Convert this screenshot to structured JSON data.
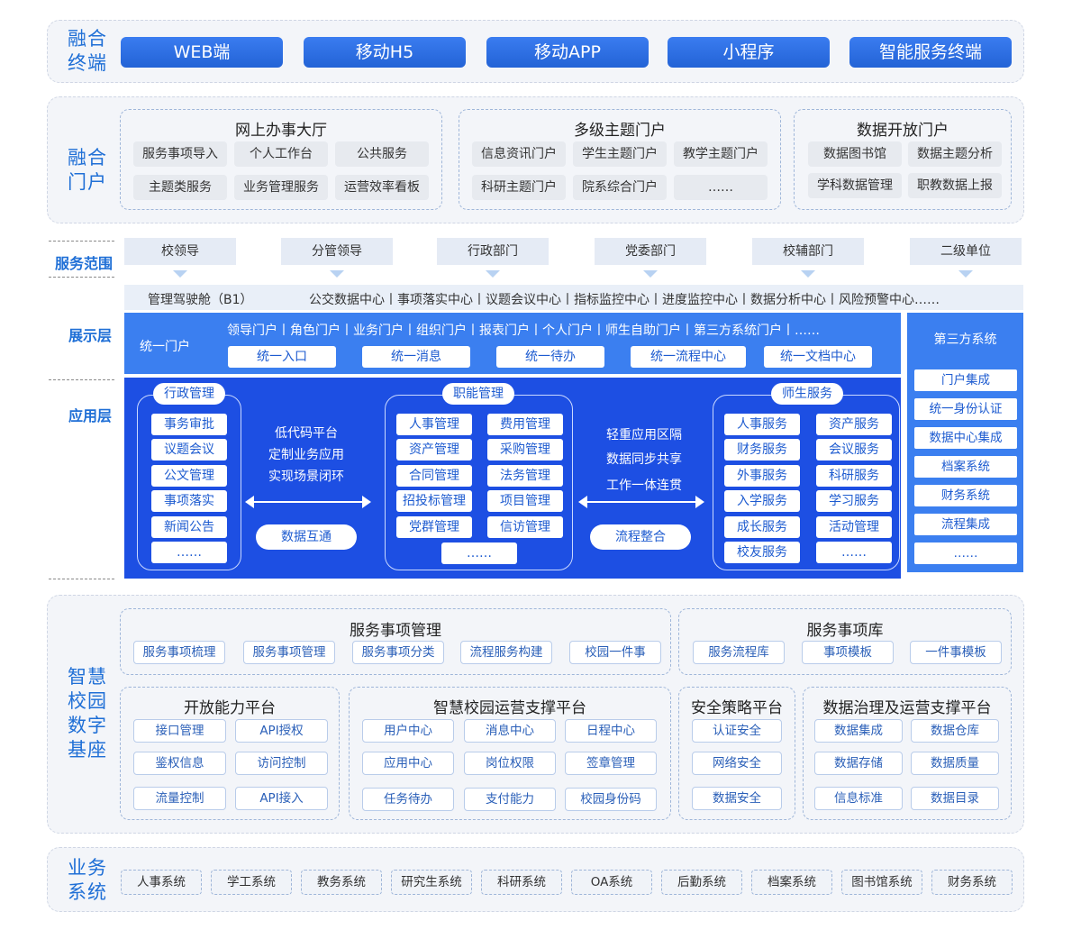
{
  "terminal": {
    "label": [
      "融合",
      "终端"
    ],
    "buttons": [
      "WEB端",
      "移动H5",
      "移动APP",
      "小程序",
      "智能服务终端"
    ]
  },
  "portal": {
    "label": [
      "融合",
      "门户"
    ],
    "groups": [
      {
        "title": "网上办事大厅",
        "items": [
          "服务事项导入",
          "个人工作台",
          "公共服务",
          "主题类服务",
          "业务管理服务",
          "运营效率看板"
        ]
      },
      {
        "title": "多级主题门户",
        "items": [
          "信息资讯门户",
          "学生主题门户",
          "教学主题门户",
          "科研主题门户",
          "院系综合门户",
          "……"
        ]
      },
      {
        "title": "数据开放门户",
        "items": [
          "数据图书馆",
          "数据主题分析",
          "学科数据管理",
          "职教数据上报"
        ]
      }
    ]
  },
  "scope": {
    "label": "服务范围",
    "items": [
      "校领导",
      "分管领导",
      "行政部门",
      "党委部门",
      "校辅部门",
      "二级单位"
    ]
  },
  "cockpit": {
    "title": "管理驾驶舱（B1）",
    "items": "公交数据中心丨事项落实中心丨议题会议中心丨指标监控中心丨进度监控中心丨数据分析中心丨风险预警中心……"
  },
  "display": {
    "label": "展示层",
    "portal_name": "统一门户",
    "portal_list": "领导门户丨角色门户丨业务门户丨组织门户丨报表门户丨个人门户丨师生自助门户丨第三方系统门户丨……",
    "buttons": [
      "统一入口",
      "统一消息",
      "统一待办",
      "统一流程中心",
      "统一文档中心"
    ]
  },
  "app": {
    "label": "应用层",
    "admin": {
      "title": "行政管理",
      "items": [
        "事务审批",
        "议题会议",
        "公文管理",
        "事项落实",
        "新闻公告",
        "……"
      ]
    },
    "mid_text": [
      "低代码平台",
      "定制业务应用",
      "实现场景闭环"
    ],
    "mid_pill": "数据互通",
    "func": {
      "title": "职能管理",
      "left": [
        "人事管理",
        "资产管理",
        "合同管理",
        "招投标管理",
        "党群管理"
      ],
      "right": [
        "费用管理",
        "采购管理",
        "法务管理",
        "项目管理",
        "信访管理"
      ],
      "more": "……"
    },
    "mid2_text": [
      "轻重应用区隔",
      "数据同步共享",
      "工作一体连贯"
    ],
    "mid2_pill": "流程整合",
    "service": {
      "title": "师生服务",
      "left": [
        "人事服务",
        "财务服务",
        "外事服务",
        "入学服务",
        "成长服务",
        "校友服务"
      ],
      "right": [
        "资产服务",
        "会议服务",
        "科研服务",
        "学习服务",
        "活动管理",
        "……"
      ]
    }
  },
  "third": {
    "title": "第三方系统",
    "items": [
      "门户集成",
      "统一身份认证",
      "数据中心集成",
      "档案系统",
      "财务系统",
      "流程集成",
      "……"
    ]
  },
  "base": {
    "label": [
      "智慧",
      "校园",
      "数字",
      "基座"
    ],
    "svc_mgmt": {
      "title": "服务事项管理",
      "items": [
        "服务事项梳理",
        "服务事项管理",
        "服务事项分类",
        "流程服务构建",
        "校园一件事"
      ]
    },
    "svc_lib": {
      "title": "服务事项库",
      "items": [
        "服务流程库",
        "事项模板",
        "一件事模板"
      ]
    },
    "open": {
      "title": "开放能力平台",
      "items": [
        "接口管理",
        "API授权",
        "鉴权信息",
        "访问控制",
        "流量控制",
        "API接入"
      ]
    },
    "ops": {
      "title": "智慧校园运营支撑平台",
      "items": [
        "用户中心",
        "消息中心",
        "日程中心",
        "应用中心",
        "岗位权限",
        "签章管理",
        "任务待办",
        "支付能力",
        "校园身份码"
      ]
    },
    "sec": {
      "title": "安全策略平台",
      "items": [
        "认证安全",
        "网络安全",
        "数据安全"
      ]
    },
    "data": {
      "title": "数据治理及运营支撑平台",
      "items": [
        "数据集成",
        "数据仓库",
        "数据存储",
        "数据质量",
        "信息标准",
        "数据目录"
      ]
    }
  },
  "biz": {
    "label": [
      "业务",
      "系统"
    ],
    "items": [
      "人事系统",
      "学工系统",
      "教务系统",
      "研究生系统",
      "科研系统",
      "OA系统",
      "后勤系统",
      "档案系统",
      "图书馆系统",
      "财务系统"
    ]
  },
  "colors": {
    "accent": "#2f6fe0",
    "dark_blue": "#1d4fe3",
    "light_blue": "#3b7ff0"
  }
}
